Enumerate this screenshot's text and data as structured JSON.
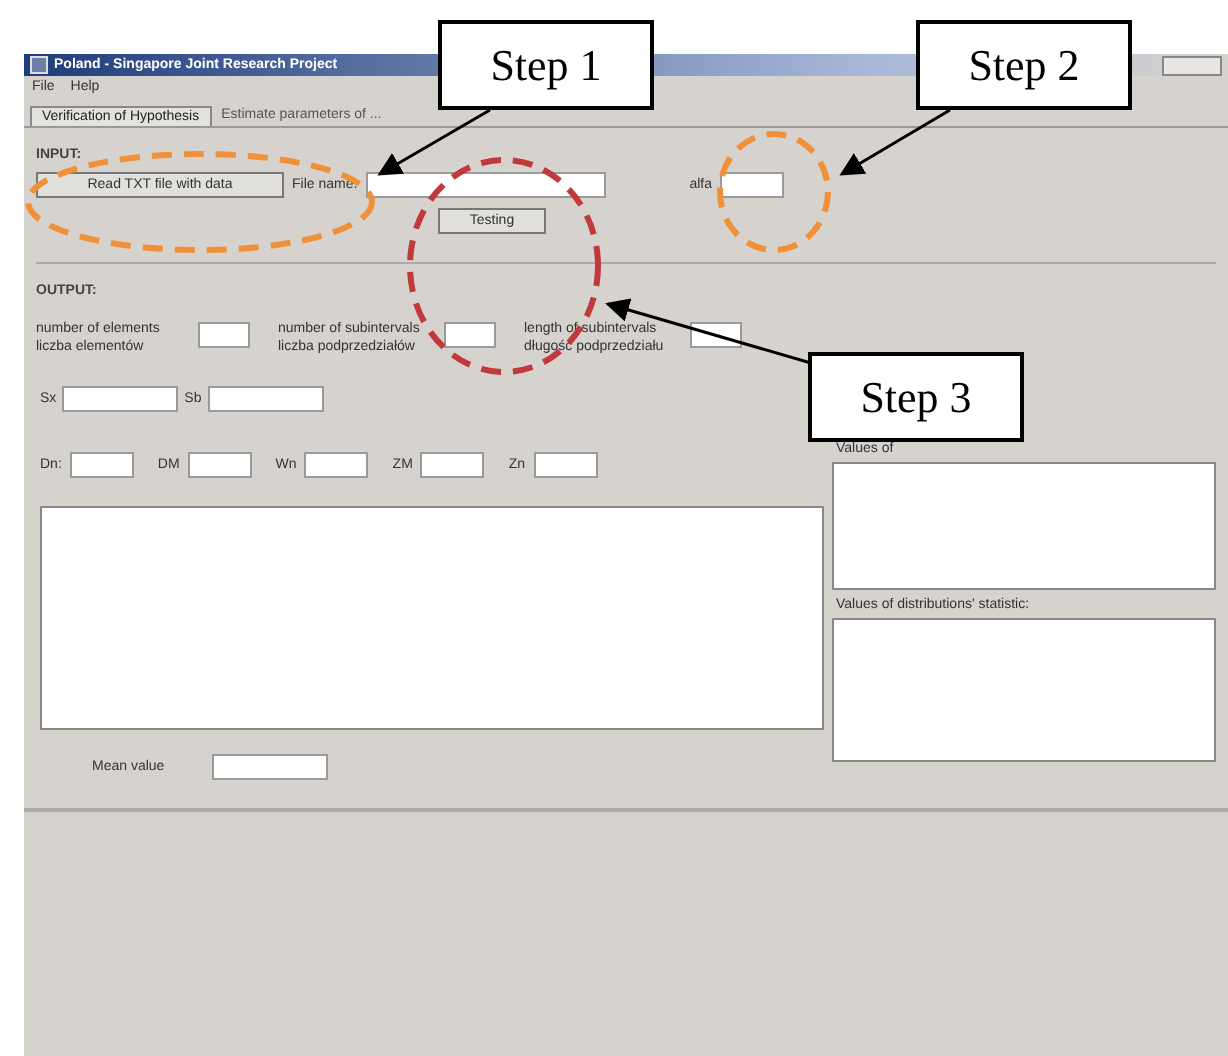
{
  "window": {
    "title": "Poland - Singapore Joint Research Project"
  },
  "menu": [
    "File",
    "Help"
  ],
  "tabs": [
    {
      "label": "Verification of Hypothesis",
      "selected": true
    },
    {
      "label": "Estimate parameters of ...",
      "selected": false
    }
  ],
  "input": {
    "heading": "INPUT:",
    "read_button": "Read TXT file with data",
    "file_label": "File name:",
    "alfa_label": "alfa",
    "test_button": "Testing"
  },
  "output": {
    "heading": "OUTPUT:",
    "counts": [
      {
        "label": "number of elements",
        "sublabel": "liczba elementów"
      },
      {
        "label": "number of subintervals",
        "sublabel": "liczba podprzedziałów"
      },
      {
        "label": "length of subintervals",
        "sublabel": "długość podprzedziału"
      }
    ],
    "stats_row_1": [
      "Sx",
      "Sb"
    ],
    "stats_row_2": [
      "Dn:",
      "DM",
      "Wn",
      "ZM",
      "Zn"
    ],
    "mean_label": "Mean value",
    "right_labels": [
      "Values of",
      "Values of distributions' statistic:"
    ]
  },
  "callouts": [
    {
      "label": "Step 1",
      "color": "#f0913a"
    },
    {
      "label": "Step 2",
      "color": "#f0913a"
    },
    {
      "label": "Step 3",
      "color": "#c0393b"
    }
  ]
}
